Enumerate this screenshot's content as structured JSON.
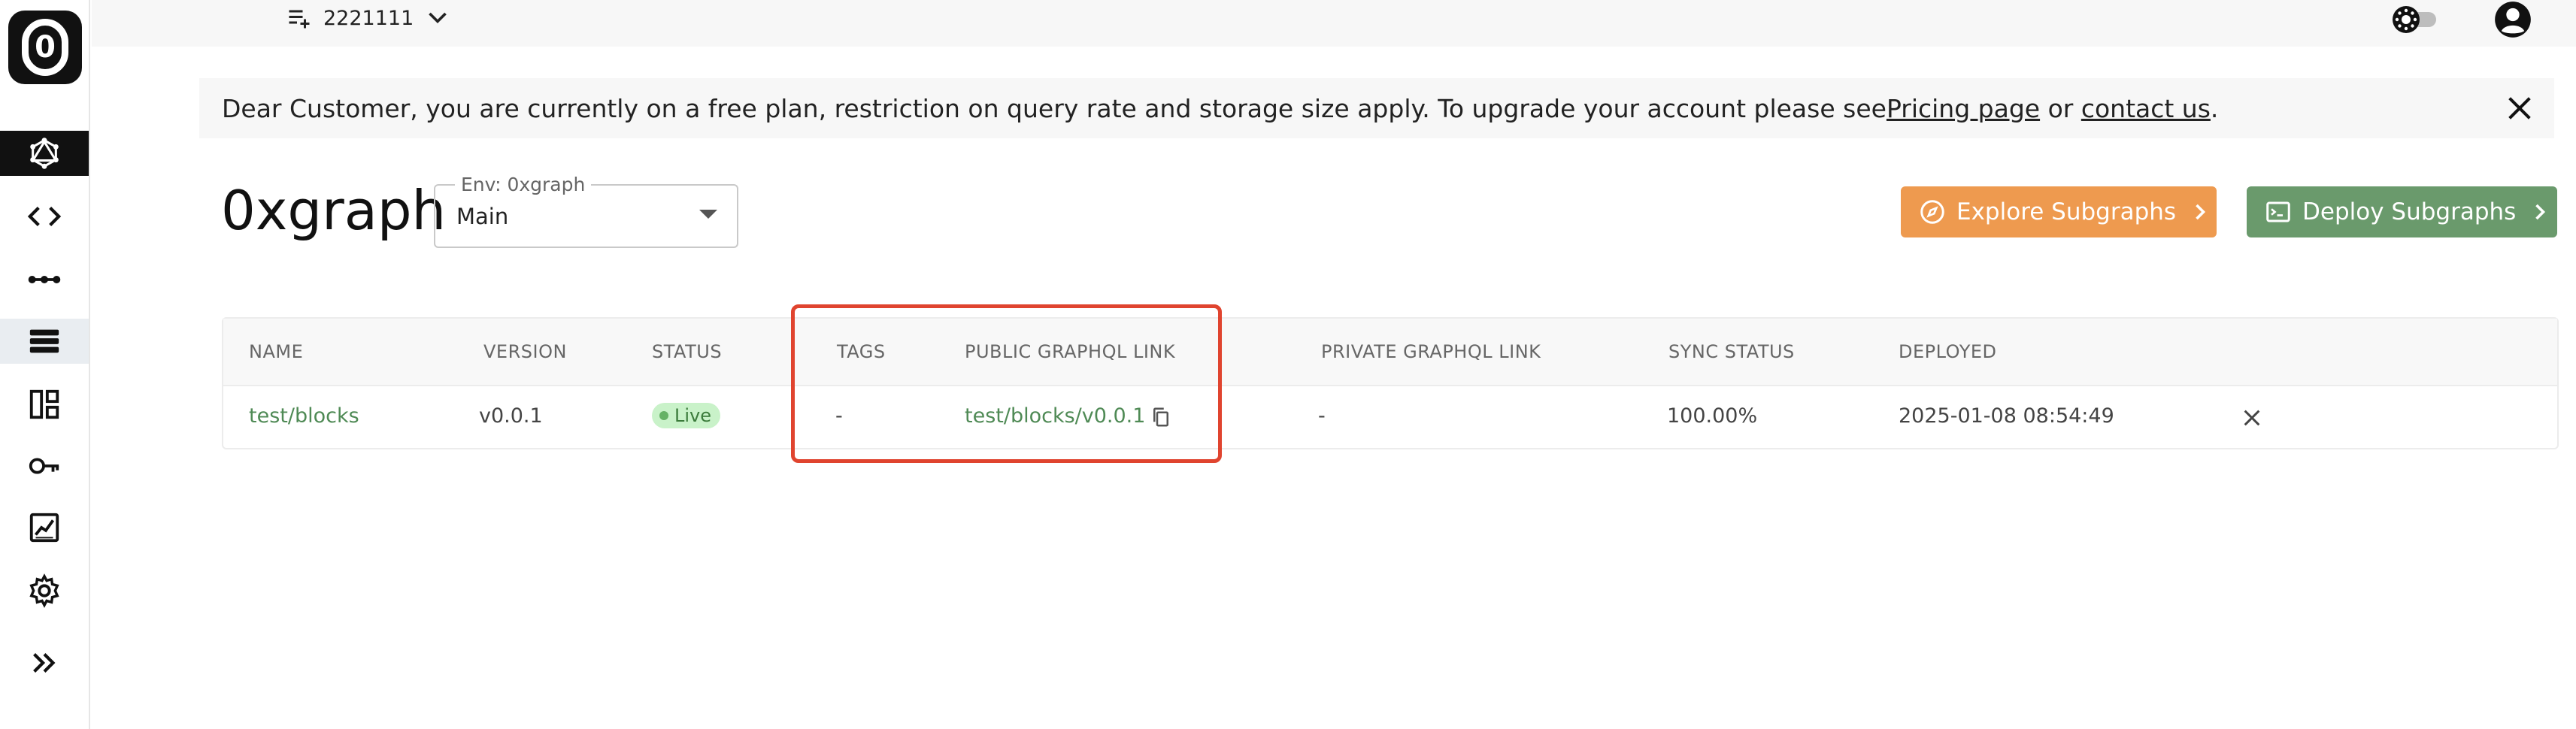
{
  "sidebar": {
    "logo_text": "0",
    "items": [
      {
        "name": "graphql-icon",
        "active": true
      },
      {
        "name": "code-icon"
      },
      {
        "name": "pipeline-icon"
      },
      {
        "name": "database-icon",
        "selected": true
      },
      {
        "name": "dashboard-icon"
      },
      {
        "name": "key-icon"
      },
      {
        "name": "chart-icon"
      },
      {
        "name": "gear-icon"
      },
      {
        "name": "expand-icon"
      }
    ]
  },
  "topbar": {
    "project_name": "2221111"
  },
  "banner": {
    "text_before": "Dear Customer, you are currently on a free plan, restriction on query rate and storage size apply. To upgrade your account please see ",
    "pricing_link": "Pricing page",
    "text_middle": " or ",
    "contact_link": "contact us",
    "text_after": "."
  },
  "page": {
    "title": "0xgraph",
    "env_label": "Env: 0xgraph",
    "env_value": "Main"
  },
  "buttons": {
    "explore": "Explore Subgraphs",
    "deploy": "Deploy Subgraphs"
  },
  "table": {
    "headers": [
      "NAME",
      "VERSION",
      "STATUS",
      "TAGS",
      "PUBLIC GRAPHQL LINK",
      "PRIVATE GRAPHQL LINK",
      "SYNC STATUS",
      "DEPLOYED"
    ],
    "rows": [
      {
        "name": "test/blocks",
        "version": "v0.0.1",
        "status": "Live",
        "tags": "-",
        "public_link": "test/blocks/v0.0.1",
        "private_link": "-",
        "sync_status": "100.00%",
        "deployed": "2025-01-08 08:54:49"
      }
    ]
  },
  "colors": {
    "accent_orange": "#ee9a4f",
    "accent_green": "#6a9a6c",
    "link_green": "#4f8a55",
    "highlight_red": "#e0442f"
  }
}
